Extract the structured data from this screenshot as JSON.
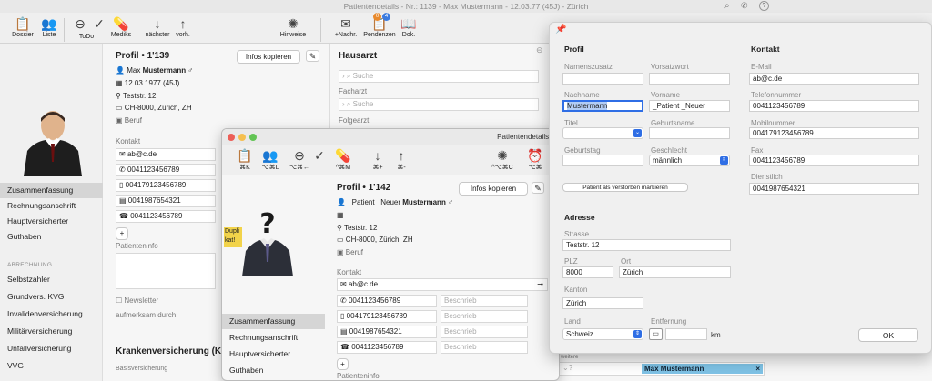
{
  "main": {
    "title": "Patientendetails - Nr.: 1139 - Max Mustermann - 12.03.77 (45J) - Zürich",
    "toolbar": {
      "dossier": "Dossier",
      "liste": "Liste",
      "todo": "ToDo",
      "mediks": "Mediks",
      "naechster": "nächster",
      "vorh": "vorh.",
      "hinweise": "Hinweise",
      "nachr": "+Nachr.",
      "pendenzen": "Pendenzen",
      "dok": "Dok.",
      "badge_orange": "0",
      "badge_blue": "4"
    },
    "sidebar": {
      "items": [
        "Zusammenfassung",
        "Rechnungsanschrift",
        "Hauptversicherter",
        "Guthaben"
      ],
      "section": "ABRECHNUNG",
      "billing": [
        "Selbstzahler",
        "Grundvers. KVG",
        "Invalidenversicherung",
        "Militärversicherung",
        "Unfallversicherung",
        "VVG"
      ]
    },
    "profile": {
      "title": "Profil • 1'139",
      "infos_button": "Infos kopieren",
      "name_first": "Max",
      "name_last": "Mustermann",
      "birth": "12.03.1977 (45J)",
      "street": "Teststr. 12",
      "city": "CH-8000, Zürich, ZH",
      "beruf": "Beruf",
      "kontakt_label": "Kontakt",
      "email": "ab@c.de",
      "phones": [
        "0041123456789",
        "004179123456789",
        "0041987654321",
        "0041123456789"
      ],
      "add": "+",
      "patienteninfo": "Patienteninfo",
      "newsletter": "Newsletter",
      "aufmerksam": "aufmerksam durch:",
      "kranken": "Krankenversicherung (K",
      "basisversicherung": "Basisversicherung"
    },
    "hausarzt": {
      "title": "Hausarzt",
      "search": "Suche",
      "facharzt": "Facharzt",
      "folgearzt": "Folgearzt",
      "weitere": "weitere",
      "tag": "Max Mustermann"
    }
  },
  "win2": {
    "title": "Patientendetails -",
    "toolbar_shortcuts": [
      "⌘K",
      "⌥⌘L",
      "⌥⌘←",
      "^⌘M",
      "⌘+",
      "⌘-",
      "^⌥⌘C",
      "⌥⌘"
    ],
    "sidebar": [
      "Zusammenfassung",
      "Rechnungsanschrift",
      "Hauptversicherter",
      "Guthaben"
    ],
    "duplikat": "Dupli\nkat!",
    "profile": {
      "title": "Profil • 1'142",
      "infos_button": "Infos kopieren",
      "name_first": "_Patient _Neuer",
      "name_last": "Mustermann",
      "street": "Teststr. 12",
      "city": "CH-8000, Zürich, ZH",
      "beruf": "Beruf",
      "kontakt_label": "Kontakt",
      "email": "ab@c.de",
      "phones": [
        "0041123456789",
        "004179123456789",
        "0041987654321",
        "0041123456789"
      ],
      "beschrieb": "Beschrieb",
      "add": "+",
      "patienteninfo": "Patienteninfo"
    }
  },
  "popover": {
    "profil": "Profil",
    "kontakt": "Kontakt",
    "namenszusatz": "Namenszusatz",
    "vorsatzwort": "Vorsatzwort",
    "nachname_label": "Nachname",
    "nachname": "Mustermann",
    "vorname_label": "Vorname",
    "vorname": "_Patient _Neuer",
    "titel_label": "Titel",
    "geburtsname_label": "Geburtsname",
    "geburtstag_label": "Geburtstag",
    "geschlecht_label": "Geschlecht",
    "geschlecht": "männlich",
    "verstorben_button": "Patient als verstorben markieren",
    "email_label": "E-Mail",
    "email": "ab@c.de",
    "tel_label": "Telefonnummer",
    "tel": "0041123456789",
    "mobil_label": "Mobilnummer",
    "mobil": "004179123456789",
    "fax_label": "Fax",
    "fax": "0041123456789",
    "dienst_label": "Dienstlich",
    "dienst": "0041987654321",
    "adresse": "Adresse",
    "strasse_label": "Strasse",
    "strasse": "Teststr. 12",
    "plz_label": "PLZ",
    "plz": "8000",
    "ort_label": "Ort",
    "ort": "Zürich",
    "kanton_label": "Kanton",
    "kanton": "Zürich",
    "land_label": "Land",
    "land": "Schweiz",
    "entfernung_label": "Entfernung",
    "km": "km",
    "ok": "OK"
  },
  "colors": {
    "accent": "#2f6ee5",
    "tag": "#7fc3e6",
    "badge_orange": "#e8892c",
    "badge_blue": "#3a7be0"
  }
}
